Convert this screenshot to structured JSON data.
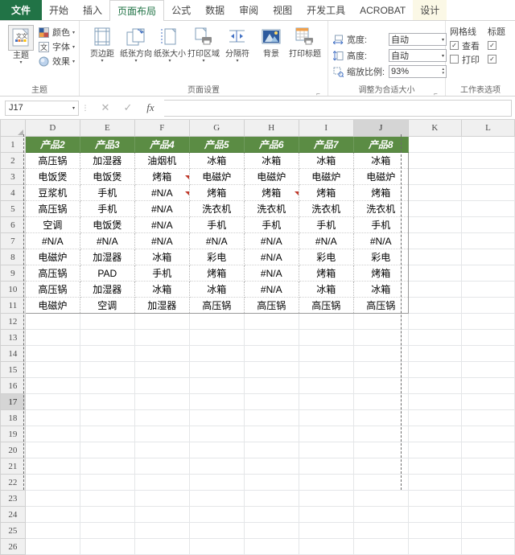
{
  "window": {
    "app": "Excel"
  },
  "tabs": [
    {
      "label": "文件",
      "kind": "file"
    },
    {
      "label": "开始",
      "kind": "normal"
    },
    {
      "label": "插入",
      "kind": "normal"
    },
    {
      "label": "页面布局",
      "kind": "active"
    },
    {
      "label": "公式",
      "kind": "normal"
    },
    {
      "label": "数据",
      "kind": "normal"
    },
    {
      "label": "审阅",
      "kind": "normal"
    },
    {
      "label": "视图",
      "kind": "normal"
    },
    {
      "label": "开发工具",
      "kind": "normal"
    },
    {
      "label": "ACROBAT",
      "kind": "normal"
    },
    {
      "label": "设计",
      "kind": "contextual"
    }
  ],
  "ribbon": {
    "groups": {
      "theme": {
        "label": "主题",
        "big": {
          "caption": "主题",
          "icon": "theme-icon"
        },
        "items": [
          {
            "label": "颜色",
            "icon": "colors-icon",
            "dropdown": "▾"
          },
          {
            "label": "字体",
            "icon": "fonts-icon",
            "dropdown": "▾"
          },
          {
            "label": "效果",
            "icon": "effects-icon",
            "dropdown": "▾"
          }
        ]
      },
      "page_setup": {
        "label": "页面设置",
        "items": [
          {
            "label": "页边距",
            "icon": "margins-icon",
            "dropdown": "▾"
          },
          {
            "label": "纸张方向",
            "icon": "orientation-icon",
            "dropdown": "▾"
          },
          {
            "label": "纸张大小",
            "icon": "size-icon",
            "dropdown": "▾"
          },
          {
            "label": "打印区域",
            "icon": "print-area-icon",
            "dropdown": "▾"
          },
          {
            "label": "分隔符",
            "icon": "breaks-icon",
            "dropdown": "▾"
          },
          {
            "label": "背景",
            "icon": "background-icon",
            "dropdown": ""
          },
          {
            "label": "打印标题",
            "icon": "print-titles-icon",
            "dropdown": ""
          }
        ]
      },
      "scale_to_fit": {
        "label": "调整为合适大小",
        "width": {
          "label": "宽度:",
          "value": "自动",
          "icon": "width-icon"
        },
        "height": {
          "label": "高度:",
          "value": "自动",
          "icon": "height-icon"
        },
        "scale": {
          "label": "缩放比例:",
          "value": "93%",
          "icon": "scale-icon"
        }
      },
      "sheet_options": {
        "label": "工作表选项",
        "gridlines": {
          "head": "网格线",
          "view": {
            "label": "查看",
            "checked": true
          },
          "print": {
            "label": "打印",
            "checked": false
          }
        },
        "headings": {
          "head": "标题",
          "view": {
            "label": "",
            "checked": true
          },
          "print": {
            "label": "",
            "checked": true
          }
        }
      }
    }
  },
  "formula_bar": {
    "name_box": "J17",
    "cancel_icon": "✕",
    "accept_icon": "✓",
    "fx_icon": "fx",
    "formula_value": ""
  },
  "sheet": {
    "columns": [
      "D",
      "E",
      "F",
      "G",
      "H",
      "I",
      "J",
      "K",
      "L"
    ],
    "selected_column": "J",
    "selected_row": 17,
    "selected_cell": "J17",
    "rows": [
      1,
      2,
      3,
      4,
      5,
      6,
      7,
      8,
      9,
      10,
      11,
      12,
      13,
      14,
      15,
      16,
      17,
      18,
      19,
      20,
      21,
      22,
      23,
      24,
      25,
      26
    ],
    "header_row": [
      "产品2",
      "产品3",
      "产品4",
      "产品5",
      "产品6",
      "产品7",
      "产品8"
    ],
    "data": [
      [
        "高压锅",
        "加湿器",
        "油烟机",
        "冰箱",
        "冰箱",
        "冰箱",
        "冰箱"
      ],
      [
        "电饭煲",
        "电饭煲",
        "烤箱",
        "电磁炉",
        "电磁炉",
        "电磁炉",
        "电磁炉"
      ],
      [
        "豆浆机",
        "手机",
        "#N/A",
        "烤箱",
        "烤箱",
        "烤箱",
        "烤箱"
      ],
      [
        "高压锅",
        "手机",
        "#N/A",
        "洗衣机",
        "洗衣机",
        "洗衣机",
        "洗衣机"
      ],
      [
        "空调",
        "电饭煲",
        "#N/A",
        "手机",
        "手机",
        "手机",
        "手机"
      ],
      [
        "#N/A",
        "#N/A",
        "#N/A",
        "#N/A",
        "#N/A",
        "#N/A",
        "#N/A"
      ],
      [
        "电磁炉",
        "加湿器",
        "冰箱",
        "彩电",
        "#N/A",
        "彩电",
        "彩电"
      ],
      [
        "高压锅",
        "PAD",
        "手机",
        "烤箱",
        "#N/A",
        "烤箱",
        "烤箱"
      ],
      [
        "高压锅",
        "加湿器",
        "冰箱",
        "冰箱",
        "#N/A",
        "冰箱",
        "冰箱"
      ],
      [
        "电磁炉",
        "空调",
        "加湿器",
        "高压锅",
        "高压锅",
        "高压锅",
        "高压锅"
      ]
    ],
    "comment_cells": [
      {
        "row": 3,
        "col": 2
      },
      {
        "row": 4,
        "col": 2
      },
      {
        "row": 4,
        "col": 4
      }
    ]
  }
}
